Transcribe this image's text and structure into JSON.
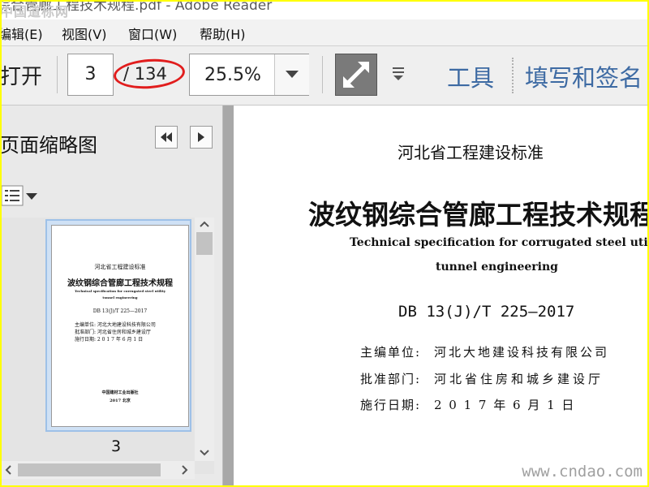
{
  "window": {
    "title": "综合管廊工程技术规程.pdf - Adobe Reader",
    "watermark": "中国道标网"
  },
  "menu": [
    "编辑(E)",
    "视图(V)",
    "窗口(W)",
    "帮助(H)"
  ],
  "toolbar": {
    "open_label": "打开",
    "current_page": "3",
    "total_pages": "/ 134",
    "zoom": "25.5%",
    "tools_label": "工具",
    "fill_sign_label": "填写和签名"
  },
  "sidebar": {
    "title": "页面缩略图",
    "thumbnail": {
      "page_label": "3",
      "header": "河北省工程建设标准",
      "title": "波纹钢综合管廊工程技术规程",
      "subtitle_en_1": "Technical specification for corrugated steel utility",
      "subtitle_en_2": "tunnel engineering",
      "code": "DB 13(J)/T 225—2017",
      "editor": "主编单位:  河北大地建设科技有限公司",
      "approver": "批准部门:  河北省住房和城乡建设厅",
      "date": "施行日期:  2 0 1 7 年 6 月 1 日",
      "publisher": "中国建材工业出版社",
      "year_city": "2017  北京"
    }
  },
  "document": {
    "header": "河北省工程建设标准",
    "title": "波纹钢综合管廊工程技术规程",
    "subtitle_en_1": "Technical specification for corrugated steel utility",
    "subtitle_en_2": "tunnel engineering",
    "code": "DB 13(J)/T 225—2017",
    "editor_label": "主编单位:",
    "editor_value": "河北大地建设科技有限公司",
    "approver_label": "批准部门:",
    "approver_value": "河北省住房和城乡建设厅",
    "date_label": "施行日期:",
    "date_value": "2 0 1 7 年 6 月 1 日",
    "watermark": "www.cndao.com"
  },
  "colors": {
    "annotation_circle": "#e11d1d",
    "link_blue": "#3d6aa3",
    "outer_border": "#ffff00"
  }
}
